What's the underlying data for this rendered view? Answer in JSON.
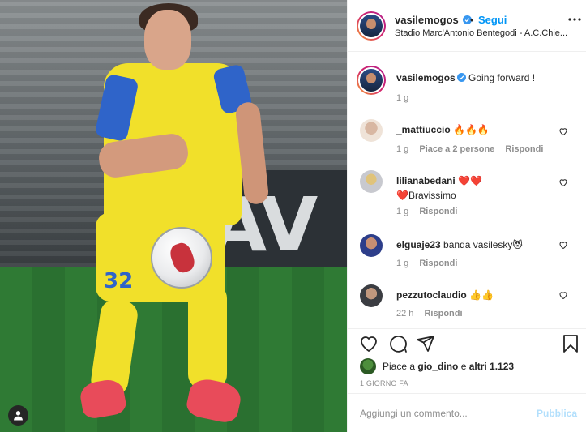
{
  "post": {
    "username": "vasilemogos",
    "follow_label": "Segui",
    "separator": "•",
    "location": "Stadio Marc'Antonio Bentegodi - A.C.Chie...",
    "caption": "Going forward !",
    "caption_time": "1 g",
    "photo_number": "32",
    "photo_banner_text": "AV"
  },
  "comments": [
    {
      "username": "_mattiuccio",
      "text": "🔥🔥🔥",
      "time": "1 g",
      "likes": "Piace a 2 persone",
      "reply": "Rispondi"
    },
    {
      "username": "lilianabedani",
      "text": "❤️❤️",
      "text2": "❤️Bravissimo",
      "time": "1 g",
      "reply": "Rispondi"
    },
    {
      "username": "elguaje23",
      "text": "banda vasilesky😻",
      "time": "1 g",
      "reply": "Rispondi"
    },
    {
      "username": "pezzutoclaudio",
      "text": "👍👍",
      "time": "22 h",
      "reply": "Rispondi"
    }
  ],
  "likes": {
    "prefix": "Piace a ",
    "user": "gio_dino",
    "middle": " e ",
    "others": "altri 1.123"
  },
  "post_time": "1 GIORNO FA",
  "comment_box": {
    "placeholder": "Aggiungi un commento...",
    "publish_label": "Pubblica"
  },
  "colors": {
    "accent_blue": "#0095f6",
    "publish_disabled": "#b2dffc",
    "jersey_yellow": "#f1e02a",
    "jersey_blue": "#2f64c9"
  },
  "icons": {
    "verified": "verified-badge-icon",
    "more": "more-options-icon",
    "heart": "heart-icon",
    "comment": "comment-icon",
    "share": "share-icon",
    "save": "bookmark-icon",
    "user_tag": "user-tag-icon"
  }
}
